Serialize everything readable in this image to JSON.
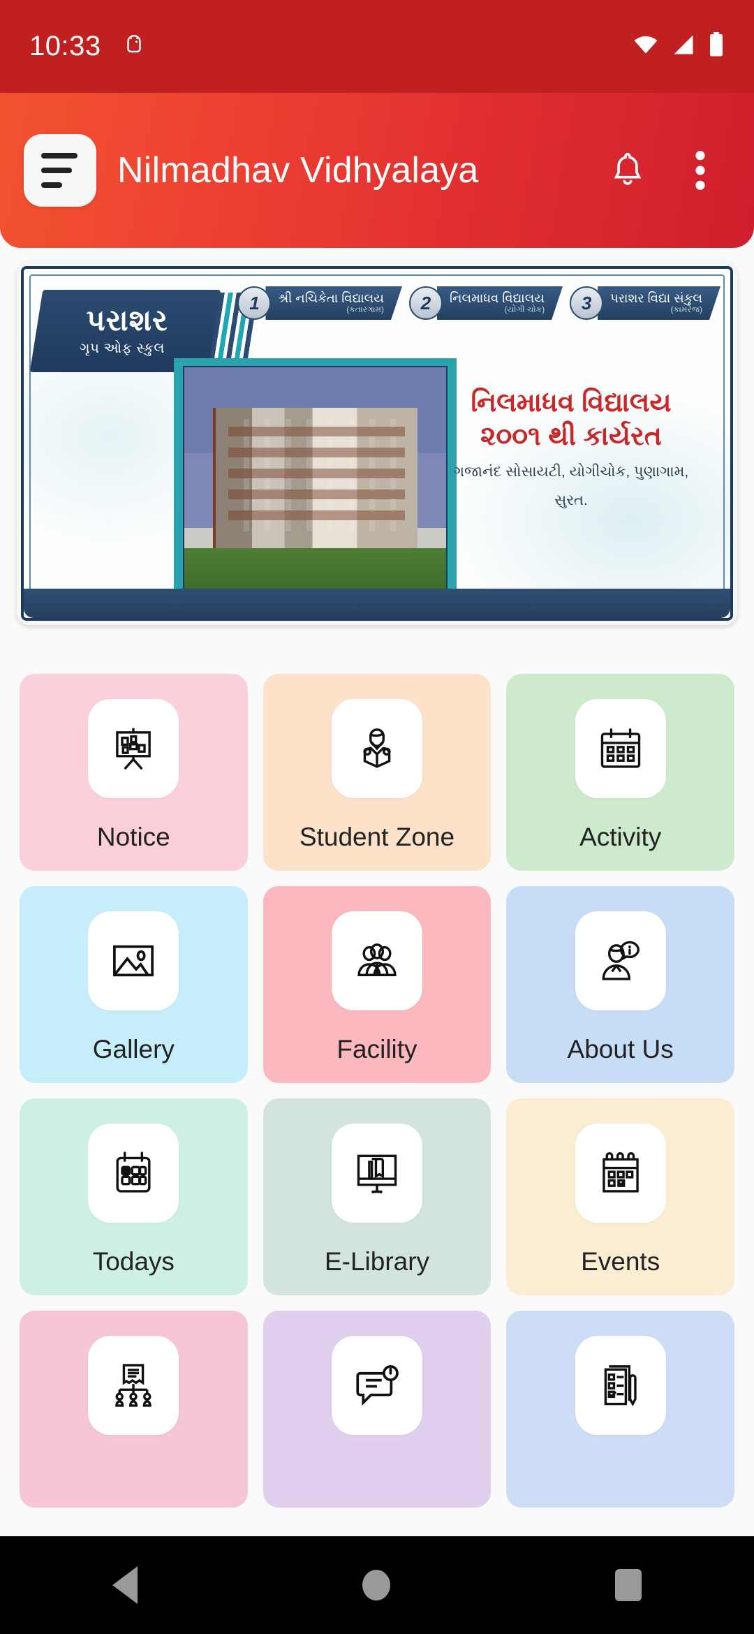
{
  "status_bar": {
    "time": "10:33",
    "icons": [
      "android-debug-icon",
      "wifi-icon",
      "signal-icon",
      "battery-icon"
    ]
  },
  "app_bar": {
    "title": "Nilmadhav Vidhyalaya",
    "menu_icon": "hamburger-menu-icon",
    "notification_icon": "bell-icon",
    "overflow_icon": "more-vertical-icon",
    "gradient_start": "#F2522F",
    "gradient_end": "#CE1E2C"
  },
  "banner": {
    "logo_main": "પરાશર",
    "logo_sub": "ગૃપ ઓફ સ્કુલ",
    "tabs": [
      {
        "num": "1",
        "title": "શ્રી નચિકેતા વિદ્યાલય",
        "sub": "(કતારગામ)"
      },
      {
        "num": "2",
        "title": "નિલમાધવ વિદ્યાલય",
        "sub": "(યોગી ચોક)"
      },
      {
        "num": "3",
        "title": "પરાશર વિદ્યા સંકુલ",
        "sub": "(કામરેજ)"
      }
    ],
    "headline": "નિલમાધવ વિદ્યાલય",
    "subline": "૨૦૦૧ થી કાર્યરત",
    "address_line1": "ગજાનંદ સોસાયટી, યોગીચોક, પુણાગામ,",
    "address_line2": "સુરત."
  },
  "tiles": [
    {
      "label": "Notice",
      "icon": "notice-board-icon",
      "bg": "#FBD0DB"
    },
    {
      "label": "Student Zone",
      "icon": "student-reading-icon",
      "bg": "#FCE2C8"
    },
    {
      "label": "Activity",
      "icon": "calendar-icon",
      "bg": "#CEEACC"
    },
    {
      "label": "Gallery",
      "icon": "image-icon",
      "bg": "#C6EEFA"
    },
    {
      "label": "Facility",
      "icon": "people-group-icon",
      "bg": "#FBB8BE"
    },
    {
      "label": "About Us",
      "icon": "person-info-icon",
      "bg": "#C7DDF5"
    },
    {
      "label": "Todays",
      "icon": "calendar-today-icon",
      "bg": "#CDF0E3"
    },
    {
      "label": "E-Library",
      "icon": "monitor-book-icon",
      "bg": "#D2E3E0"
    },
    {
      "label": "Events",
      "icon": "calendar-check-icon",
      "bg": "#FAEDD2"
    },
    {
      "label": "",
      "icon": "org-chart-icon",
      "bg": "#F6C6D7"
    },
    {
      "label": "",
      "icon": "chat-clock-icon",
      "bg": "#E0CFEE"
    },
    {
      "label": "",
      "icon": "checklist-pen-icon",
      "bg": "#CDDDF5"
    }
  ],
  "nav_bar": {
    "back": "back-icon",
    "home": "home-icon",
    "recents": "recents-icon"
  }
}
